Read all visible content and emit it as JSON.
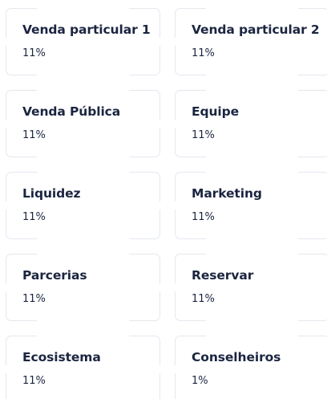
{
  "cards": [
    {
      "title": "Venda particular 1",
      "value": "11%"
    },
    {
      "title": "Venda particular 2",
      "value": "11%"
    },
    {
      "title": "Venda Pública",
      "value": "11%"
    },
    {
      "title": "Equipe",
      "value": "11%"
    },
    {
      "title": "Liquidez",
      "value": "11%"
    },
    {
      "title": "Marketing",
      "value": "11%"
    },
    {
      "title": "Parcerias",
      "value": "11%"
    },
    {
      "title": "Reservar",
      "value": "11%"
    },
    {
      "title": "Ecosistema",
      "value": "11%"
    },
    {
      "title": "Conselheiros",
      "value": "1%"
    }
  ]
}
